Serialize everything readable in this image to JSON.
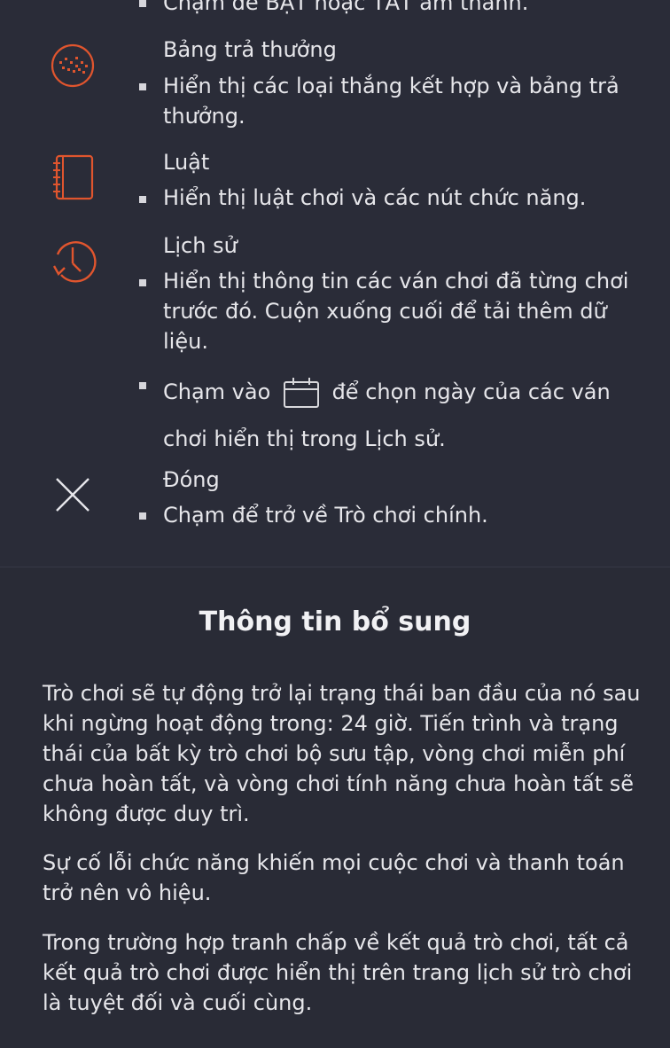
{
  "top_partial": {
    "text": "Chạm để BẬT hoặc TẮT âm thanh."
  },
  "items": [
    {
      "icon": "paytable-icon",
      "title": "Bảng trả thưởng",
      "bullets": [
        "Hiển thị các loại thắng kết hợp và bảng trả thưởng."
      ]
    },
    {
      "icon": "rules-notebook-icon",
      "title": "Luật",
      "bullets": [
        "Hiển thị luật chơi và các nút chức năng."
      ]
    },
    {
      "icon": "history-clock-icon",
      "title": "Lịch sử",
      "bullets": [
        "Hiển thị thông tin các ván chơi đã từng chơi trước đó. Cuộn xuống cuối để tải thêm dữ liệu.",
        {
          "prefix": "Chạm vào",
          "suffix": "để chọn ngày của các ván chơi hiển thị trong Lịch sử."
        }
      ]
    },
    {
      "icon": "close-icon",
      "title": "Đóng",
      "bullets": [
        "Chạm để trở về Trò chơi chính."
      ]
    }
  ],
  "additional_info": {
    "title": "Thông tin bổ sung",
    "paragraphs": [
      "Trò chơi sẽ tự động trở lại trạng thái ban đầu của nó sau khi ngừng hoạt động trong: 24 giờ. Tiến trình và trạng thái của bất kỳ trò chơi bộ sưu tập, vòng chơi miễn phí chưa hoàn tất, và vòng chơi tính năng chưa hoàn tất sẽ không được duy trì.",
      "Sự cố lỗi chức năng khiến mọi cuộc chơi và thanh toán trở nên vô hiệu.",
      "Trong trường hợp tranh chấp về kết quả trò chơi, tất cả kết quả trò chơi được hiển thị trên trang lịch sử trò chơi là tuyệt đối và cuối cùng."
    ]
  },
  "colors": {
    "accent": "#e0552e",
    "background": "#2a2c38",
    "text": "#e6e6ea"
  }
}
